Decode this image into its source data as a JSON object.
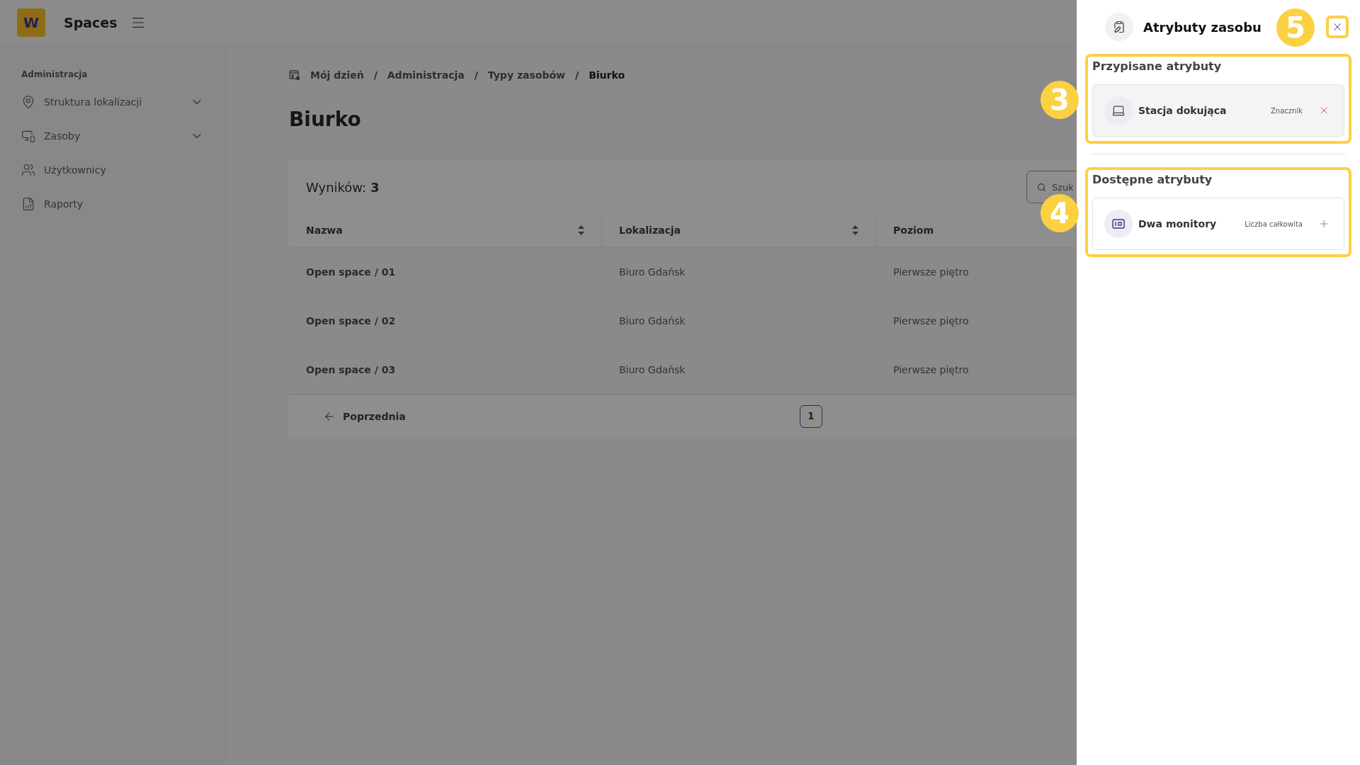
{
  "header": {
    "logo": "W",
    "app_name": "Spaces"
  },
  "sidebar": {
    "section": "Administracja",
    "items": [
      {
        "label": "Struktura lokalizacji",
        "expandable": true
      },
      {
        "label": "Zasoby",
        "expandable": true
      },
      {
        "label": "Użytkownicy",
        "expandable": false
      },
      {
        "label": "Raporty",
        "expandable": false
      }
    ]
  },
  "breadcrumb": [
    {
      "label": "Mój dzień",
      "current": false
    },
    {
      "label": "Administracja",
      "current": false
    },
    {
      "label": "Typy zasobów",
      "current": false
    },
    {
      "label": "Biurko",
      "current": true
    }
  ],
  "breadcrumb_separator": "/",
  "page_title": "Biurko",
  "results": {
    "label": "Wyników:",
    "count": "3"
  },
  "search": {
    "placeholder": "Szuk"
  },
  "table": {
    "columns": [
      {
        "label": "Nazwa",
        "sortable": true
      },
      {
        "label": "Lokalizacja",
        "sortable": true
      },
      {
        "label": "Poziom"
      }
    ],
    "rows": [
      [
        "Open space / 01",
        "Biuro Gdańsk",
        "Pierwsze piętro"
      ],
      [
        "Open space / 02",
        "Biuro Gdańsk",
        "Pierwsze piętro"
      ],
      [
        "Open space / 03",
        "Biuro Gdańsk",
        "Pierwsze piętro"
      ]
    ]
  },
  "pagination": {
    "previous": "Poprzednia",
    "pages": [
      {
        "label": "1",
        "selected": true
      }
    ]
  },
  "drawer": {
    "title": "Atrybuty zasobu",
    "close_highlighted": true,
    "close_callout": "5",
    "sections": [
      {
        "title": "Przypisane atrybuty",
        "highlighted": true,
        "callout": "3",
        "items": [
          {
            "name": "Stacja dokująca",
            "type": "Znacznik",
            "assigned": true
          }
        ]
      },
      {
        "title": "Dostępne atrybuty",
        "highlighted": true,
        "callout": "4",
        "items": [
          {
            "name": "Dwa monitory",
            "type": "Liczba całkowita",
            "assigned": false
          }
        ]
      }
    ]
  }
}
